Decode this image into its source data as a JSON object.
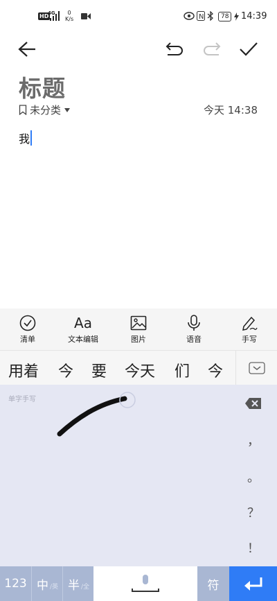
{
  "status_bar": {
    "hd": "HD",
    "network_type": "4G",
    "speed_value": "0",
    "speed_unit": "K/s",
    "battery": "78",
    "time": "14:39"
  },
  "note": {
    "title": "标题",
    "category": "未分类",
    "timestamp": "今天 14:38",
    "body": "我"
  },
  "toolbar": [
    {
      "label": "清单",
      "icon": "checklist-icon"
    },
    {
      "label": "文本编辑",
      "icon": "text-format-icon",
      "glyph": "Aa"
    },
    {
      "label": "图片",
      "icon": "image-icon"
    },
    {
      "label": "语音",
      "icon": "microphone-icon"
    },
    {
      "label": "手写",
      "icon": "handwriting-pen-icon"
    }
  ],
  "candidates": [
    "用着",
    "今",
    "要",
    "今天",
    "们",
    "今天"
  ],
  "keyboard": {
    "mode_label": "单字手写",
    "side_punctuation": [
      "，",
      "。",
      "？",
      "！"
    ],
    "bottom": {
      "num": "123",
      "chinese_main": "中",
      "chinese_sub": "/英",
      "half_main": "半",
      "half_sub": "/全",
      "symbol": "符"
    }
  },
  "colors": {
    "keyboard_bg": "#e5e7f3",
    "key_blue": "#a9b7d3",
    "enter_key": "#2f7cf6",
    "cursor": "#2f7cf6"
  }
}
